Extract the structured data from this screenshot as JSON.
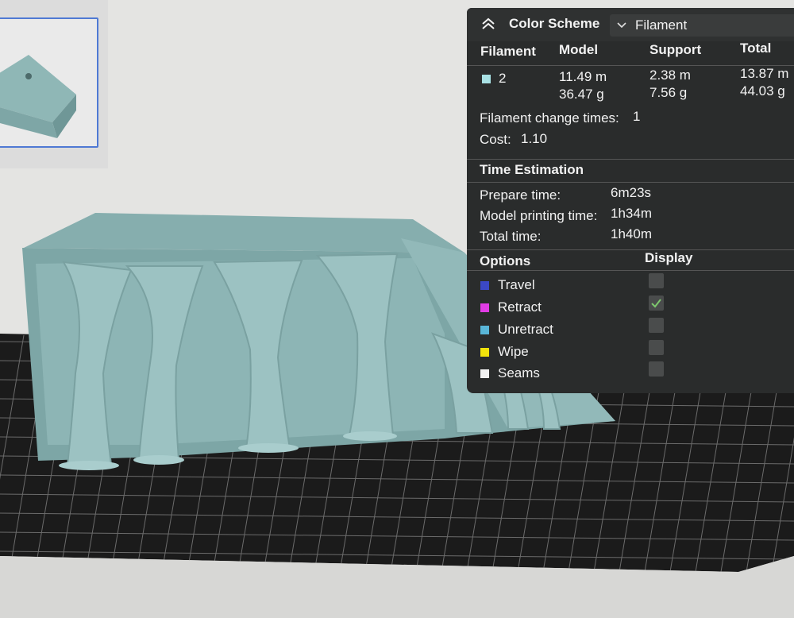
{
  "colors": {
    "panel_bg": "#2a2c2c",
    "model_fill": "#8fb7b6",
    "travel": "#3b48c4",
    "retract": "#e23ce6",
    "unretract": "#59b6d8",
    "wipe": "#f1e30b",
    "seams": "#f2f2f2",
    "filament_swatch": "#a8e1e4",
    "check": "#7ec86e"
  },
  "header": {
    "title": "Color Scheme",
    "collapse_icon": "double-chevron-up-icon",
    "select_icon": "chevron-down-icon",
    "select_value": "Filament"
  },
  "filament_table": {
    "columns": [
      "Filament",
      "Model",
      "Support",
      "Total"
    ],
    "rows": [
      {
        "filament": "2",
        "model_length": "11.49 m",
        "model_weight": "36.47 g",
        "support_length": "2.38 m",
        "support_weight": "7.56 g",
        "total_length": "13.87 m",
        "total_weight": "44.03 g"
      }
    ]
  },
  "summary": {
    "change_label": "Filament change times:",
    "change_value": "1",
    "cost_label": "Cost:",
    "cost_value": "1.10"
  },
  "time": {
    "heading": "Time Estimation",
    "prepare_label": "Prepare time:",
    "prepare_value": "6m23s",
    "model_label": "Model printing time:",
    "model_value": "1h34m",
    "total_label": "Total time:",
    "total_value": "1h40m"
  },
  "options": {
    "heading": "Options",
    "display_heading": "Display",
    "items": [
      {
        "label": "Travel",
        "checked": false
      },
      {
        "label": "Retract",
        "checked": true
      },
      {
        "label": "Unretract",
        "checked": false
      },
      {
        "label": "Wipe",
        "checked": false
      },
      {
        "label": "Seams",
        "checked": false
      }
    ]
  }
}
